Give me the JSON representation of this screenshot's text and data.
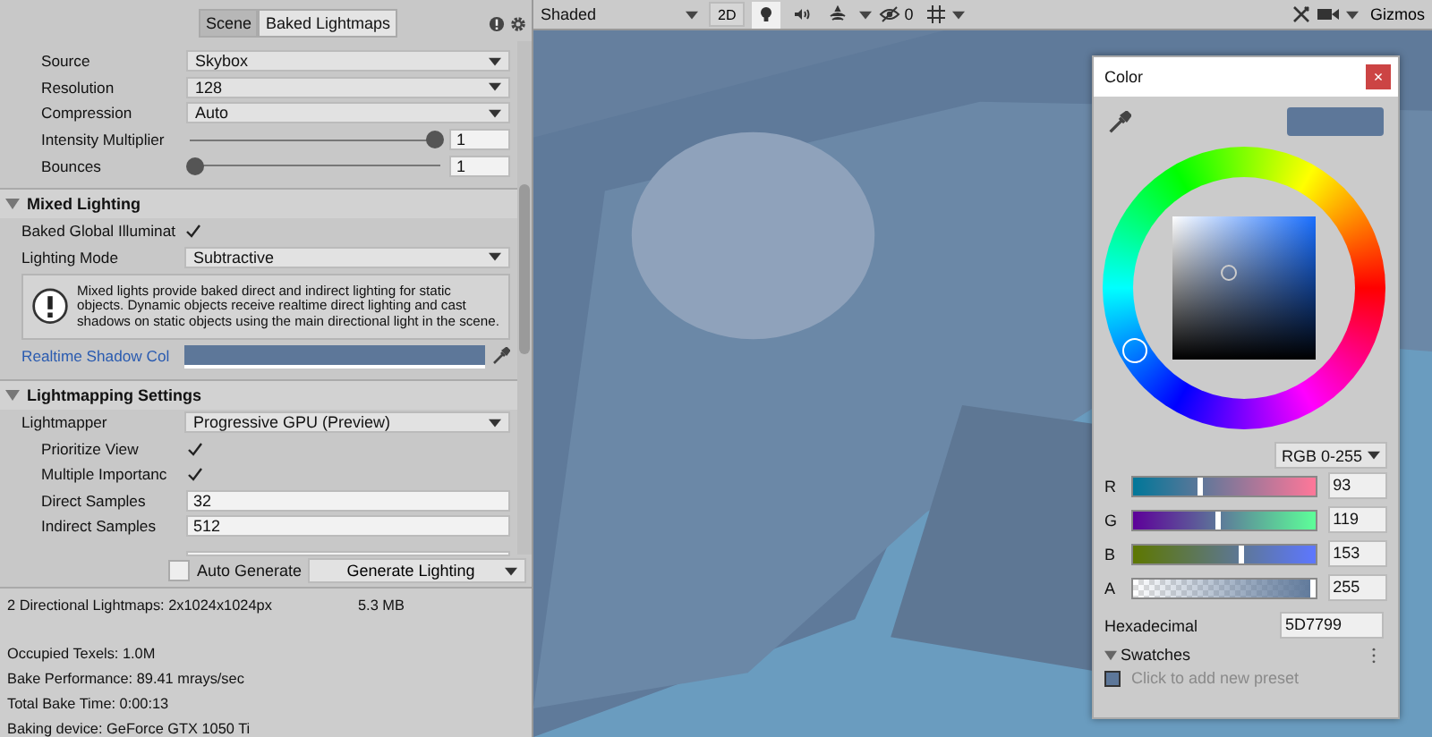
{
  "inspector": {
    "tabs": [
      {
        "label": "Scene",
        "selected": true
      },
      {
        "label": "Baked Lightmaps",
        "selected": false
      }
    ],
    "environment_rows": [
      {
        "kind": "dropdown",
        "label": "Source",
        "value": "Skybox"
      },
      {
        "kind": "dropdown",
        "label": "Resolution",
        "value": "128"
      },
      {
        "kind": "dropdown",
        "label": "Compression",
        "value": "Auto"
      },
      {
        "kind": "slider",
        "label": "Intensity Multiplier",
        "level": 1,
        "value": "1"
      },
      {
        "kind": "slider",
        "label": "Bounces",
        "level": 0,
        "value": "1"
      }
    ],
    "sections": [
      {
        "title": "Mixed Lighting",
        "expanded": true,
        "rows": [
          {
            "kind": "checkbox",
            "label": "Baked Global Illuminat",
            "checked": true
          },
          {
            "kind": "dropdown",
            "label": "Lighting Mode",
            "value": "Subtractive"
          },
          {
            "kind": "help",
            "text": "Mixed lights provide baked direct and indirect lighting for static objects. Dynamic objects receive realtime direct lighting and cast shadows on static objects using the main directional light in the scene."
          },
          {
            "kind": "color",
            "label": "Realtime Shadow Col",
            "color": "#5d7799"
          }
        ]
      },
      {
        "title": "Lightmapping Settings",
        "expanded": true,
        "rows": [
          {
            "kind": "dropdown",
            "label": "Lightmapper",
            "value": "Progressive GPU (Preview)",
            "children": [
              {
                "kind": "checkbox",
                "label": "Prioritize View",
                "checked": true
              },
              {
                "kind": "checkbox",
                "label": "Multiple Importanc",
                "checked": true
              },
              {
                "kind": "text",
                "label": "Direct Samples",
                "value": "32"
              },
              {
                "kind": "text",
                "label": "Indirect Samples",
                "value": "512"
              }
            ]
          }
        ]
      }
    ],
    "auto_generate": {
      "label": "Auto Generate",
      "checked": false
    },
    "generate_button": "Generate Lighting",
    "stats": [
      {
        "text": "2 Directional Lightmaps: 2x1024x1024px",
        "size": "5.3 MB"
      },
      {
        "text": "Occupied Texels: 1.0M"
      },
      {
        "text": "Bake Performance: 89.41 mrays/sec"
      },
      {
        "text": "Total Bake Time: 0:00:13"
      },
      {
        "text": "Baking device: GeForce GTX 1050 Ti"
      }
    ]
  },
  "scene_toolbar": {
    "shading": "Shaded",
    "mode_2d": "2D",
    "hidden_count": "0",
    "gizmos": "Gizmos",
    "toggles": [
      {
        "kind": "light",
        "selected": true
      },
      {
        "kind": "audio",
        "selected": false
      },
      {
        "kind": "effects",
        "selected": false
      }
    ]
  },
  "color_picker": {
    "title": "Color",
    "close": "×",
    "color": "#5d7799",
    "mode": "RGB 0-255",
    "channels": [
      {
        "name": "R",
        "level": 0.365,
        "value": "93"
      },
      {
        "name": "G",
        "level": 0.467,
        "value": "119"
      },
      {
        "name": "B",
        "level": 0.6,
        "value": "153"
      },
      {
        "name": "A",
        "level": 1,
        "value": "255"
      }
    ],
    "hex_label": "Hexadecimal",
    "hex": "5D7799",
    "swatches": {
      "title": "Swatches",
      "expanded": true,
      "hint": "Click to add new preset"
    }
  }
}
